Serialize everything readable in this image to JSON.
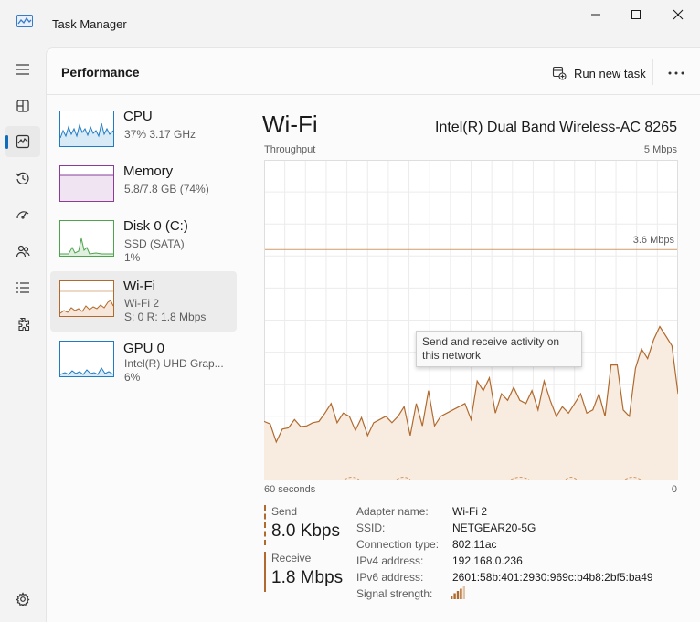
{
  "window": {
    "title": "Task Manager"
  },
  "header": {
    "page_title": "Performance",
    "run_new_task": "Run new task"
  },
  "rail": {
    "active": "performance",
    "items": [
      "menu",
      "processes",
      "performance",
      "app-history",
      "startup-apps",
      "users",
      "details",
      "services",
      "settings"
    ]
  },
  "resources": [
    {
      "name": "CPU",
      "sub1": "37%  3.17 GHz",
      "sub2": "",
      "color": "#1f7bc3"
    },
    {
      "name": "Memory",
      "sub1": "5.8/7.8 GB (74%)",
      "sub2": "",
      "color": "#8a3c99"
    },
    {
      "name": "Disk 0 (C:)",
      "sub1": "SSD (SATA)",
      "sub2": "1%",
      "color": "#4fa34f"
    },
    {
      "name": "Wi-Fi",
      "sub1": "Wi-Fi 2",
      "sub2": "S: 0  R: 1.8 Mbps",
      "color": "#b06a2e"
    },
    {
      "name": "GPU 0",
      "sub1": "Intel(R) UHD Grap...",
      "sub2": "6%",
      "color": "#1f7bc3"
    }
  ],
  "detail": {
    "title": "Wi-Fi",
    "adapter": "Intel(R) Dual Band Wireless-AC 8265",
    "throughput_label": "Throughput",
    "max_label": "5 Mbps",
    "threshold_label": "3.6 Mbps",
    "time_label": "60 seconds",
    "zero_label": "0",
    "tooltip": "Send and receive activity on this network"
  },
  "chart_data": {
    "type": "area",
    "series": [
      {
        "values": [
          0.92,
          0.88,
          0.6,
          0.8,
          0.82,
          0.95,
          0.84,
          0.85,
          0.9,
          0.92,
          1.05,
          1.2,
          0.9,
          1.05,
          1.0,
          0.78,
          0.98,
          0.7,
          0.9,
          0.95,
          1.0,
          0.9,
          1.0,
          1.15,
          0.7,
          1.2,
          0.85,
          1.4,
          0.85,
          1.0,
          1.05,
          1.1,
          1.15,
          1.2,
          0.95,
          1.55,
          1.4,
          1.6,
          1.05,
          1.35,
          1.25,
          1.45,
          1.25,
          1.2,
          1.4,
          1.1,
          1.55,
          1.25,
          1.0,
          1.15,
          1.05,
          1.2,
          1.35,
          1.05,
          1.1,
          1.35,
          1.0,
          1.8,
          1.8,
          1.1,
          1.0,
          1.75,
          2.05,
          1.9,
          2.2,
          2.4,
          2.25,
          2.1,
          1.35
        ]
      }
    ],
    "ylim": [
      0,
      5
    ],
    "threshold": 3.6,
    "grid": true,
    "color": "#b06a2e"
  },
  "stats": {
    "send_label": "Send",
    "send_value": "8.0 Kbps",
    "receive_label": "Receive",
    "receive_value": "1.8 Mbps"
  },
  "properties": [
    {
      "label": "Adapter name:",
      "value": "Wi-Fi 2"
    },
    {
      "label": "SSID:",
      "value": "NETGEAR20-5G"
    },
    {
      "label": "Connection type:",
      "value": "802.11ac"
    },
    {
      "label": "IPv4 address:",
      "value": "192.168.0.236"
    },
    {
      "label": "IPv6 address:",
      "value": "2601:58b:401:2930:969c:b4b8:2bf5:ba49"
    },
    {
      "label": "Signal strength:",
      "value": ""
    }
  ],
  "signal_level": 4
}
